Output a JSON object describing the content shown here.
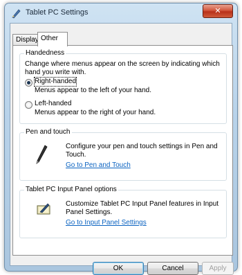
{
  "window": {
    "title": "Tablet PC Settings",
    "close_label": "✕"
  },
  "tabs": [
    {
      "label": "Display"
    },
    {
      "label": "Other"
    }
  ],
  "handedness": {
    "title": "Handedness",
    "description": "Change where menus appear on the screen by indicating which hand you write with.",
    "right_label": "Right-handed",
    "right_desc": "Menus appear to the left of your hand.",
    "left_label": "Left-handed",
    "left_desc": "Menus appear to the right of your hand.",
    "selected": "right"
  },
  "pen_touch": {
    "title": "Pen and touch",
    "description": "Configure your pen and touch settings in Pen and Touch.",
    "link": "Go to Pen and Touch"
  },
  "input_panel": {
    "title": "Tablet PC Input Panel options",
    "description": "Customize Tablet PC Input Panel features in Input Panel Settings.",
    "link": "Go to Input Panel Settings"
  },
  "buttons": {
    "ok": "OK",
    "cancel": "Cancel",
    "apply": "Apply"
  }
}
